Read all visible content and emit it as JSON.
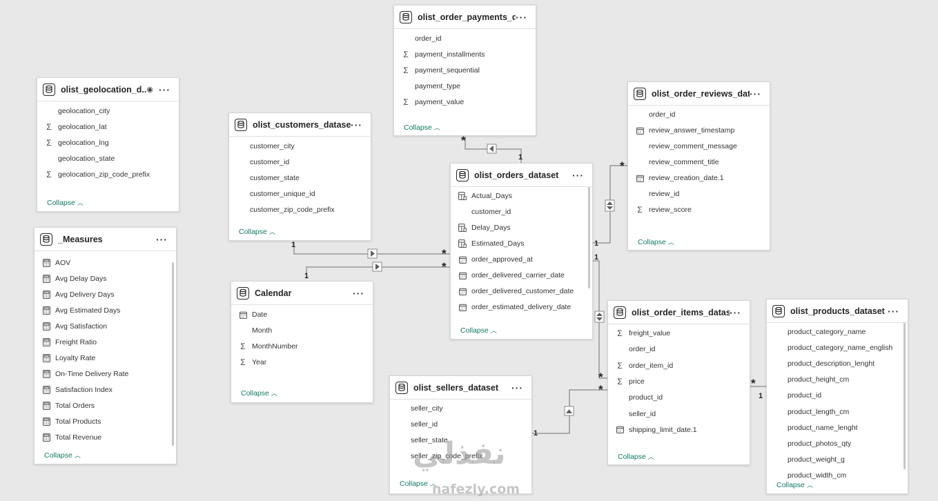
{
  "tables": {
    "geolocation": {
      "title": "olist_geolocation_d...",
      "fields": [
        {
          "icon": "none",
          "name": "geolocation_city"
        },
        {
          "icon": "sigma",
          "name": "geolocation_lat"
        },
        {
          "icon": "sigma",
          "name": "geolocation_lng"
        },
        {
          "icon": "none",
          "name": "geolocation_state"
        },
        {
          "icon": "sigma",
          "name": "geolocation_zip_code_prefix"
        }
      ],
      "collapse": "Collapse"
    },
    "measures": {
      "title": "_Measures",
      "fields": [
        {
          "icon": "calc",
          "name": "AOV"
        },
        {
          "icon": "calc",
          "name": "Avg Delay Days"
        },
        {
          "icon": "calc",
          "name": "Avg Delivery Days"
        },
        {
          "icon": "calc",
          "name": "Avg Estimated Days"
        },
        {
          "icon": "calc",
          "name": "Avg Satisfaction"
        },
        {
          "icon": "calc",
          "name": "Freight Ratio"
        },
        {
          "icon": "calc",
          "name": "Loyalty Rate"
        },
        {
          "icon": "calc",
          "name": "On-Time Delivery Rate"
        },
        {
          "icon": "calc",
          "name": "Satisfaction Index"
        },
        {
          "icon": "calc",
          "name": "Total Orders"
        },
        {
          "icon": "calc",
          "name": "Total Products"
        },
        {
          "icon": "calc",
          "name": "Total Revenue"
        }
      ],
      "collapse": "Collapse"
    },
    "customers": {
      "title": "olist_customers_dataset",
      "fields": [
        {
          "icon": "none",
          "name": "customer_city"
        },
        {
          "icon": "none",
          "name": "customer_id"
        },
        {
          "icon": "none",
          "name": "customer_state"
        },
        {
          "icon": "none",
          "name": "customer_unique_id"
        },
        {
          "icon": "none",
          "name": "customer_zip_code_prefix"
        }
      ],
      "collapse": "Collapse"
    },
    "calendar": {
      "title": "Calendar",
      "fields": [
        {
          "icon": "date",
          "name": "Date"
        },
        {
          "icon": "none",
          "name": "Month"
        },
        {
          "icon": "sigma",
          "name": "MonthNumber"
        },
        {
          "icon": "sigma",
          "name": "Year"
        }
      ],
      "collapse": "Collapse"
    },
    "payments": {
      "title": "olist_order_payments_d...",
      "fields": [
        {
          "icon": "none",
          "name": "order_id"
        },
        {
          "icon": "sigma",
          "name": "payment_installments"
        },
        {
          "icon": "sigma",
          "name": "payment_sequential"
        },
        {
          "icon": "none",
          "name": "payment_type"
        },
        {
          "icon": "sigma",
          "name": "payment_value"
        }
      ],
      "collapse": "Collapse"
    },
    "orders": {
      "title": "olist_orders_dataset",
      "fields": [
        {
          "icon": "calccol",
          "name": "Actual_Days"
        },
        {
          "icon": "none",
          "name": "customer_id"
        },
        {
          "icon": "calccol",
          "name": "Delay_Days"
        },
        {
          "icon": "calccol",
          "name": "Estimated_Days"
        },
        {
          "icon": "date",
          "name": "order_approved_at"
        },
        {
          "icon": "date",
          "name": "order_delivered_carrier_date"
        },
        {
          "icon": "date",
          "name": "order_delivered_customer_date"
        },
        {
          "icon": "date",
          "name": "order_estimated_delivery_date"
        }
      ],
      "collapse": "Collapse"
    },
    "reviews": {
      "title": "olist_order_reviews_dat...",
      "fields": [
        {
          "icon": "none",
          "name": "order_id"
        },
        {
          "icon": "date",
          "name": "review_answer_timestamp"
        },
        {
          "icon": "none",
          "name": "review_comment_message"
        },
        {
          "icon": "none",
          "name": "review_comment_title"
        },
        {
          "icon": "date",
          "name": "review_creation_date.1"
        },
        {
          "icon": "none",
          "name": "review_id"
        },
        {
          "icon": "sigma",
          "name": "review_score"
        }
      ],
      "collapse": "Collapse"
    },
    "sellers": {
      "title": "olist_sellers_dataset",
      "fields": [
        {
          "icon": "none",
          "name": "seller_city"
        },
        {
          "icon": "none",
          "name": "seller_id"
        },
        {
          "icon": "none",
          "name": "seller_state"
        },
        {
          "icon": "none",
          "name": "seller_zip_code_prefix"
        }
      ],
      "collapse": "Collapse"
    },
    "order_items": {
      "title": "olist_order_items_dataset",
      "fields": [
        {
          "icon": "sigma",
          "name": "freight_value"
        },
        {
          "icon": "none",
          "name": "order_id"
        },
        {
          "icon": "sigma",
          "name": "order_item_id"
        },
        {
          "icon": "sigma",
          "name": "price"
        },
        {
          "icon": "none",
          "name": "product_id"
        },
        {
          "icon": "none",
          "name": "seller_id"
        },
        {
          "icon": "date",
          "name": "shipping_limit_date.1"
        }
      ],
      "collapse": "Collapse"
    },
    "products": {
      "title": "olist_products_dataset",
      "fields": [
        {
          "icon": "none",
          "name": "product_category_name"
        },
        {
          "icon": "none",
          "name": "product_category_name_english"
        },
        {
          "icon": "none",
          "name": "product_description_lenght"
        },
        {
          "icon": "none",
          "name": "product_height_cm"
        },
        {
          "icon": "none",
          "name": "product_id"
        },
        {
          "icon": "none",
          "name": "product_length_cm"
        },
        {
          "icon": "none",
          "name": "product_name_lenght"
        },
        {
          "icon": "none",
          "name": "product_photos_qty"
        },
        {
          "icon": "none",
          "name": "product_weight_g"
        },
        {
          "icon": "none",
          "name": "product_width_cm"
        }
      ],
      "collapse": "Collapse"
    }
  },
  "cardinality": {
    "one": "1",
    "many": "*"
  },
  "watermark": {
    "arabic": "نفذلي",
    "latin": "nafezly.com"
  },
  "colors": {
    "canvas": "#e8e8e8",
    "collapse_link": "#117865",
    "line": "#8a8886"
  }
}
